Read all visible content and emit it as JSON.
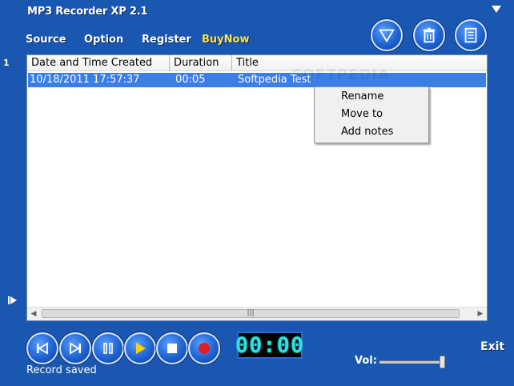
{
  "window": {
    "title": "MP3 Recorder XP 2.1"
  },
  "nav": {
    "source": "Source",
    "option": "Option",
    "register": "Register",
    "buynow": "BuyNow"
  },
  "top_buttons": [
    {
      "name": "minimize",
      "icon": "triangle-down-icon"
    },
    {
      "name": "delete",
      "icon": "trash-icon"
    },
    {
      "name": "notes",
      "icon": "notes-icon"
    }
  ],
  "panel": {
    "marker": "1"
  },
  "list": {
    "columns": [
      "Date and Time Created",
      "Duration",
      "Title"
    ],
    "rows": [
      {
        "date": "10/18/2011 17:57:37",
        "duration": "00:05",
        "title": "Softpedia Test"
      }
    ],
    "watermark": "SOFTPEDIA"
  },
  "context_menu": {
    "items": [
      "Rename",
      "Move to",
      "Add notes"
    ]
  },
  "transport": {
    "buttons": [
      "previous",
      "next",
      "pause",
      "play",
      "stop",
      "record"
    ]
  },
  "timer": {
    "display": "00:00"
  },
  "status": {
    "text": "Record saved"
  },
  "controls": {
    "exit": "Exit",
    "vol_label": "Vol:",
    "volume_level": 0.95
  },
  "colors": {
    "background": "#1a57b0",
    "selection": "#3a7ee8",
    "buy_accent": "#ffe04a",
    "timer_digits": "#2ee0e0",
    "record": "#e02020",
    "play": "#ffd400"
  }
}
